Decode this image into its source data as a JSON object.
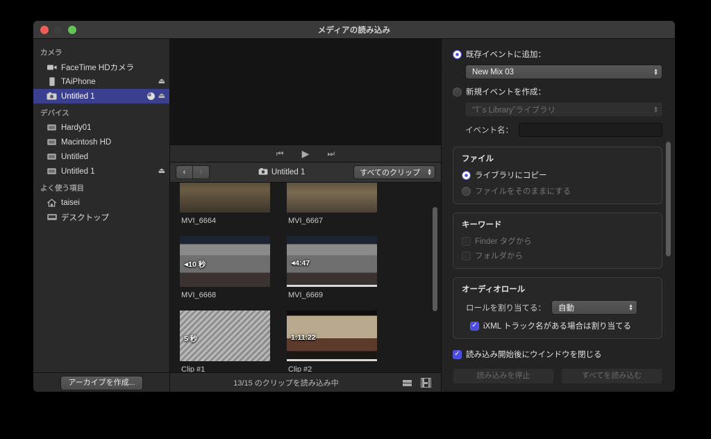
{
  "window": {
    "title": "メディアの読み込み"
  },
  "sidebar": {
    "sections": [
      {
        "header": "カメラ",
        "items": [
          {
            "label": "FaceTime HDカメラ",
            "icon": "camcorder-icon",
            "eject": false,
            "progress": false,
            "selected": false
          },
          {
            "label": "TAiPhone",
            "icon": "iphone-icon",
            "eject": true,
            "progress": false,
            "selected": false
          },
          {
            "label": "Untitled 1",
            "icon": "camera-icon",
            "eject": true,
            "progress": true,
            "selected": true
          }
        ]
      },
      {
        "header": "デバイス",
        "items": [
          {
            "label": "Hardy01",
            "icon": "harddisk-icon",
            "eject": false,
            "progress": false,
            "selected": false
          },
          {
            "label": "Macintosh HD",
            "icon": "harddisk-icon",
            "eject": false,
            "progress": false,
            "selected": false
          },
          {
            "label": "Untitled",
            "icon": "harddisk-icon",
            "eject": false,
            "progress": false,
            "selected": false
          },
          {
            "label": "Untitled 1",
            "icon": "harddisk-icon",
            "eject": true,
            "progress": false,
            "selected": false
          }
        ]
      },
      {
        "header": "よく使う項目",
        "items": [
          {
            "label": "taisei",
            "icon": "home-icon",
            "eject": false,
            "progress": false,
            "selected": false
          },
          {
            "label": "デスクトップ",
            "icon": "desktop-icon",
            "eject": false,
            "progress": false,
            "selected": false
          }
        ]
      }
    ],
    "archive_button": "アーカイブを作成..."
  },
  "browser": {
    "transport": {
      "prev": "skip-back-icon",
      "play": "play-icon",
      "next": "skip-forward-icon"
    },
    "nav": {
      "back": "‹",
      "forward": "›",
      "device_icon": "camera-icon",
      "device_name": "Untitled 1",
      "filter_value": "すべてのクリップ"
    },
    "clips": [
      {
        "name": "MVI_6664",
        "badge": "",
        "selected": false,
        "row": "partial-top"
      },
      {
        "name": "MVI_6667",
        "badge": "",
        "selected": false,
        "row": "partial-top"
      },
      {
        "name": "MVI_6668",
        "badge": "10 秒",
        "badge_arrow": true,
        "selected": false
      },
      {
        "name": "MVI_6669",
        "badge": "4:47",
        "badge_arrow": true,
        "selected": true
      },
      {
        "name": "Clip #1",
        "badge": "5 秒",
        "badge_arrow": false,
        "selected": false
      },
      {
        "name": "Clip #2",
        "badge": "1:11:22",
        "badge_arrow": false,
        "selected": true
      },
      {
        "name": "",
        "badge": "",
        "selected": false,
        "row": "partial-bottom"
      },
      {
        "name": "",
        "badge": "",
        "selected": false,
        "row": "partial-bottom"
      }
    ],
    "status": "13/15 のクリップを読み込み中",
    "view_icons": [
      "list-view-icon",
      "filmstrip-view-icon"
    ]
  },
  "options": {
    "existing_event": {
      "label": "既存イベントに追加：",
      "selected": true,
      "value": "New Mix 03"
    },
    "new_event": {
      "label": "新規イベントを作成：",
      "selected": false,
      "library_value": "“T`s Library”ライブラリ",
      "name_label": "イベント名：",
      "name_value": ""
    },
    "files": {
      "title": "ファイル",
      "copy_to_library": {
        "label": "ライブラリにコピー",
        "selected": true
      },
      "leave_in_place": {
        "label": "ファイルをそのままにする",
        "selected": false,
        "disabled": true
      }
    },
    "keywords": {
      "title": "キーワード",
      "from_finder_tags": {
        "label": "Finder タグから",
        "checked": false,
        "disabled": true
      },
      "from_folders": {
        "label": "フォルダから",
        "checked": false,
        "disabled": true
      }
    },
    "audio_roles": {
      "title": "オーディオロール",
      "assign_label": "ロールを割り当てる：",
      "assign_value": "自動",
      "ixml": {
        "label": "iXML トラック名がある場合は割り当てる",
        "checked": true
      }
    },
    "close_window": {
      "label": "読み込み開始後にウインドウを閉じる",
      "checked": true
    },
    "stop_button": "読み込みを停止",
    "import_all_button": "すべてを読み込む"
  },
  "colors": {
    "accent_blue": "#4b4be8",
    "selection_blue": "#3b3f8f",
    "window_bg": "#232323",
    "panel_bg": "#272727"
  }
}
